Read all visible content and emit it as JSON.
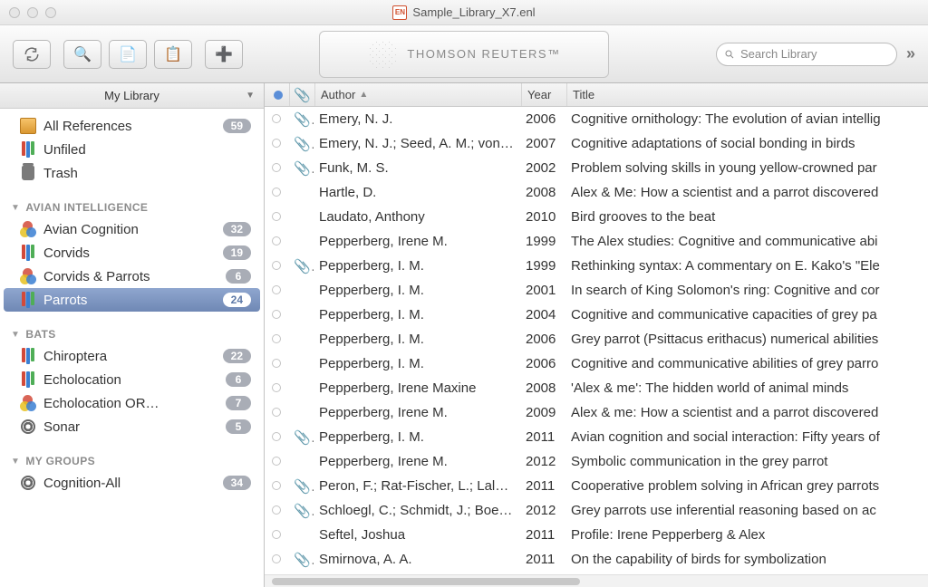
{
  "window_title": "Sample_Library_X7.enl",
  "brand": "THOMSON REUTERS™",
  "search": {
    "placeholder": "Search Library"
  },
  "sidebar": {
    "header": "My Library",
    "top": [
      {
        "label": "All References",
        "icon": "box",
        "count": 59
      },
      {
        "label": "Unfiled",
        "icon": "books",
        "count": null
      },
      {
        "label": "Trash",
        "icon": "trash",
        "count": null
      }
    ],
    "groups": [
      {
        "title": "AVIAN INTELLIGENCE",
        "items": [
          {
            "label": "Avian Cognition",
            "icon": "venn",
            "count": 32
          },
          {
            "label": "Corvids",
            "icon": "books",
            "count": 19
          },
          {
            "label": "Corvids & Parrots",
            "icon": "venn",
            "count": 6
          },
          {
            "label": "Parrots",
            "icon": "books",
            "count": 24,
            "selected": true
          }
        ]
      },
      {
        "title": "BATS",
        "items": [
          {
            "label": "Chiroptera",
            "icon": "books",
            "count": 22
          },
          {
            "label": "Echolocation",
            "icon": "books",
            "count": 6
          },
          {
            "label": "Echolocation OR…",
            "icon": "venn",
            "count": 7
          },
          {
            "label": "Sonar",
            "icon": "gear",
            "count": 5
          }
        ]
      },
      {
        "title": "MY GROUPS",
        "items": [
          {
            "label": "Cognition-All",
            "icon": "gear",
            "count": 34
          }
        ]
      }
    ]
  },
  "columns": {
    "author": "Author",
    "year": "Year",
    "title": "Title"
  },
  "rows": [
    {
      "att": true,
      "author": "Emery, N. J.",
      "year": 2006,
      "title": "Cognitive ornithology: The evolution of avian intellig"
    },
    {
      "att": true,
      "author": "Emery, N. J.; Seed, A. M.; von…",
      "year": 2007,
      "title": "Cognitive adaptations of social bonding in birds"
    },
    {
      "att": true,
      "author": "Funk, M. S.",
      "year": 2002,
      "title": "Problem solving skills in young yellow-crowned par"
    },
    {
      "att": false,
      "author": "Hartle, D.",
      "year": 2008,
      "title": "Alex & Me: How a scientist and a parrot discovered"
    },
    {
      "att": false,
      "author": "Laudato, Anthony",
      "year": 2010,
      "title": "Bird grooves to the beat"
    },
    {
      "att": false,
      "author": "Pepperberg, Irene M.",
      "year": 1999,
      "title": "The Alex studies: Cognitive and communicative abi"
    },
    {
      "att": true,
      "author": "Pepperberg, I. M.",
      "year": 1999,
      "title": "Rethinking syntax: A commentary on E. Kako's \"Ele"
    },
    {
      "att": false,
      "author": "Pepperberg, I. M.",
      "year": 2001,
      "title": "In search of King Solomon's ring: Cognitive and cor"
    },
    {
      "att": false,
      "author": "Pepperberg, I. M.",
      "year": 2004,
      "title": "Cognitive and communicative capacities of grey pa"
    },
    {
      "att": false,
      "author": "Pepperberg, I. M.",
      "year": 2006,
      "title": "Grey parrot (Psittacus erithacus) numerical abilities"
    },
    {
      "att": false,
      "author": "Pepperberg, I. M.",
      "year": 2006,
      "title": "Cognitive and communicative abilities of grey parro"
    },
    {
      "att": false,
      "author": "Pepperberg, Irene Maxine",
      "year": 2008,
      "title": "'Alex & me': The hidden world of animal minds"
    },
    {
      "att": false,
      "author": "Pepperberg, Irene M.",
      "year": 2009,
      "title": "Alex & me: How a scientist and a parrot discovered"
    },
    {
      "att": true,
      "author": "Pepperberg, I. M.",
      "year": 2011,
      "title": "Avian cognition and social interaction: Fifty years of"
    },
    {
      "att": false,
      "author": "Pepperberg, Irene M.",
      "year": 2012,
      "title": "Symbolic communication in the grey parrot"
    },
    {
      "att": true,
      "author": "Peron, F.; Rat-Fischer, L.; Lalo…",
      "year": 2011,
      "title": "Cooperative problem solving in African grey parrots"
    },
    {
      "att": true,
      "author": "Schloegl, C.; Schmidt, J.; Boe…",
      "year": 2012,
      "title": "Grey parrots use inferential reasoning based on ac"
    },
    {
      "att": false,
      "author": "Seftel, Joshua",
      "year": 2011,
      "title": "Profile: Irene Pepperberg & Alex"
    },
    {
      "att": true,
      "author": "Smirnova, A. A.",
      "year": 2011,
      "title": "On the capability of birds for symbolization"
    }
  ]
}
